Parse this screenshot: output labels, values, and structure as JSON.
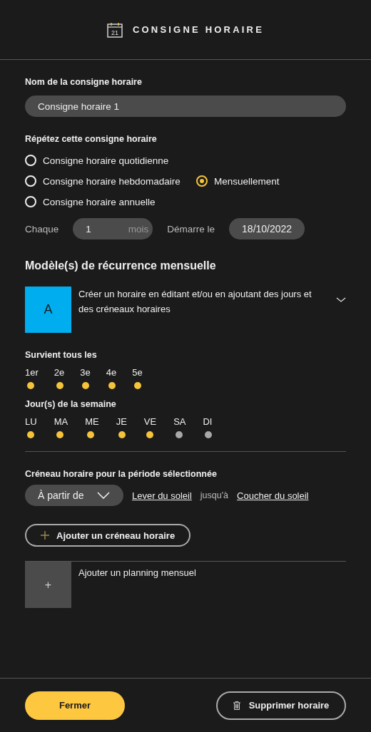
{
  "header": {
    "title": "CONSIGNE HORAIRE",
    "icon_text": "21"
  },
  "name_field": {
    "label": "Nom de la consigne horaire",
    "value": "Consigne horaire 1"
  },
  "repeat": {
    "label": "Répétez cette consigne horaire",
    "rows": [
      [
        {
          "label": "Consigne horaire quotidienne",
          "selected": false
        }
      ],
      [
        {
          "label": "Consigne horaire hebdomadaire",
          "selected": false
        },
        {
          "label": "Mensuellement",
          "selected": true
        }
      ],
      [
        {
          "label": "Consigne horaire annuelle",
          "selected": false
        }
      ]
    ]
  },
  "interval": {
    "label": "Chaque",
    "value": "1",
    "unit": "mois",
    "start_label": "Démarre le",
    "start_value": "18/10/2022"
  },
  "pattern_section": {
    "title": "Modèle(s) de récurrence mensuelle",
    "pattern": {
      "letter": "A",
      "description": "Créer un horaire en éditant et/ou en ajoutant des jours et des créneaux horaires"
    },
    "occurrence": {
      "label": "Survient tous les",
      "items": [
        {
          "label": "1er",
          "selected": true
        },
        {
          "label": "2e",
          "selected": true
        },
        {
          "label": "3e",
          "selected": true
        },
        {
          "label": "4e",
          "selected": true
        },
        {
          "label": "5e",
          "selected": true
        }
      ]
    },
    "weekdays": {
      "label": "Jour(s) de la semaine",
      "items": [
        {
          "label": "LU",
          "selected": true
        },
        {
          "label": "MA",
          "selected": true
        },
        {
          "label": "ME",
          "selected": true
        },
        {
          "label": "JE",
          "selected": true
        },
        {
          "label": "VE",
          "selected": true
        },
        {
          "label": "SA",
          "selected": false
        },
        {
          "label": "DI",
          "selected": false
        }
      ]
    },
    "time_slot": {
      "label": "Créneau horaire pour la période sélectionnée",
      "mode": "À partir de",
      "from": "Lever du soleil",
      "separator": "jusqu'à",
      "to": "Coucher du soleil"
    },
    "add_slot_button": "Ajouter un créneau horaire",
    "add_schedule": {
      "icon_text": "+",
      "label": "Ajouter un planning mensuel"
    }
  },
  "footer": {
    "close_button": "Fermer",
    "delete_button": "Supprimer horaire"
  }
}
